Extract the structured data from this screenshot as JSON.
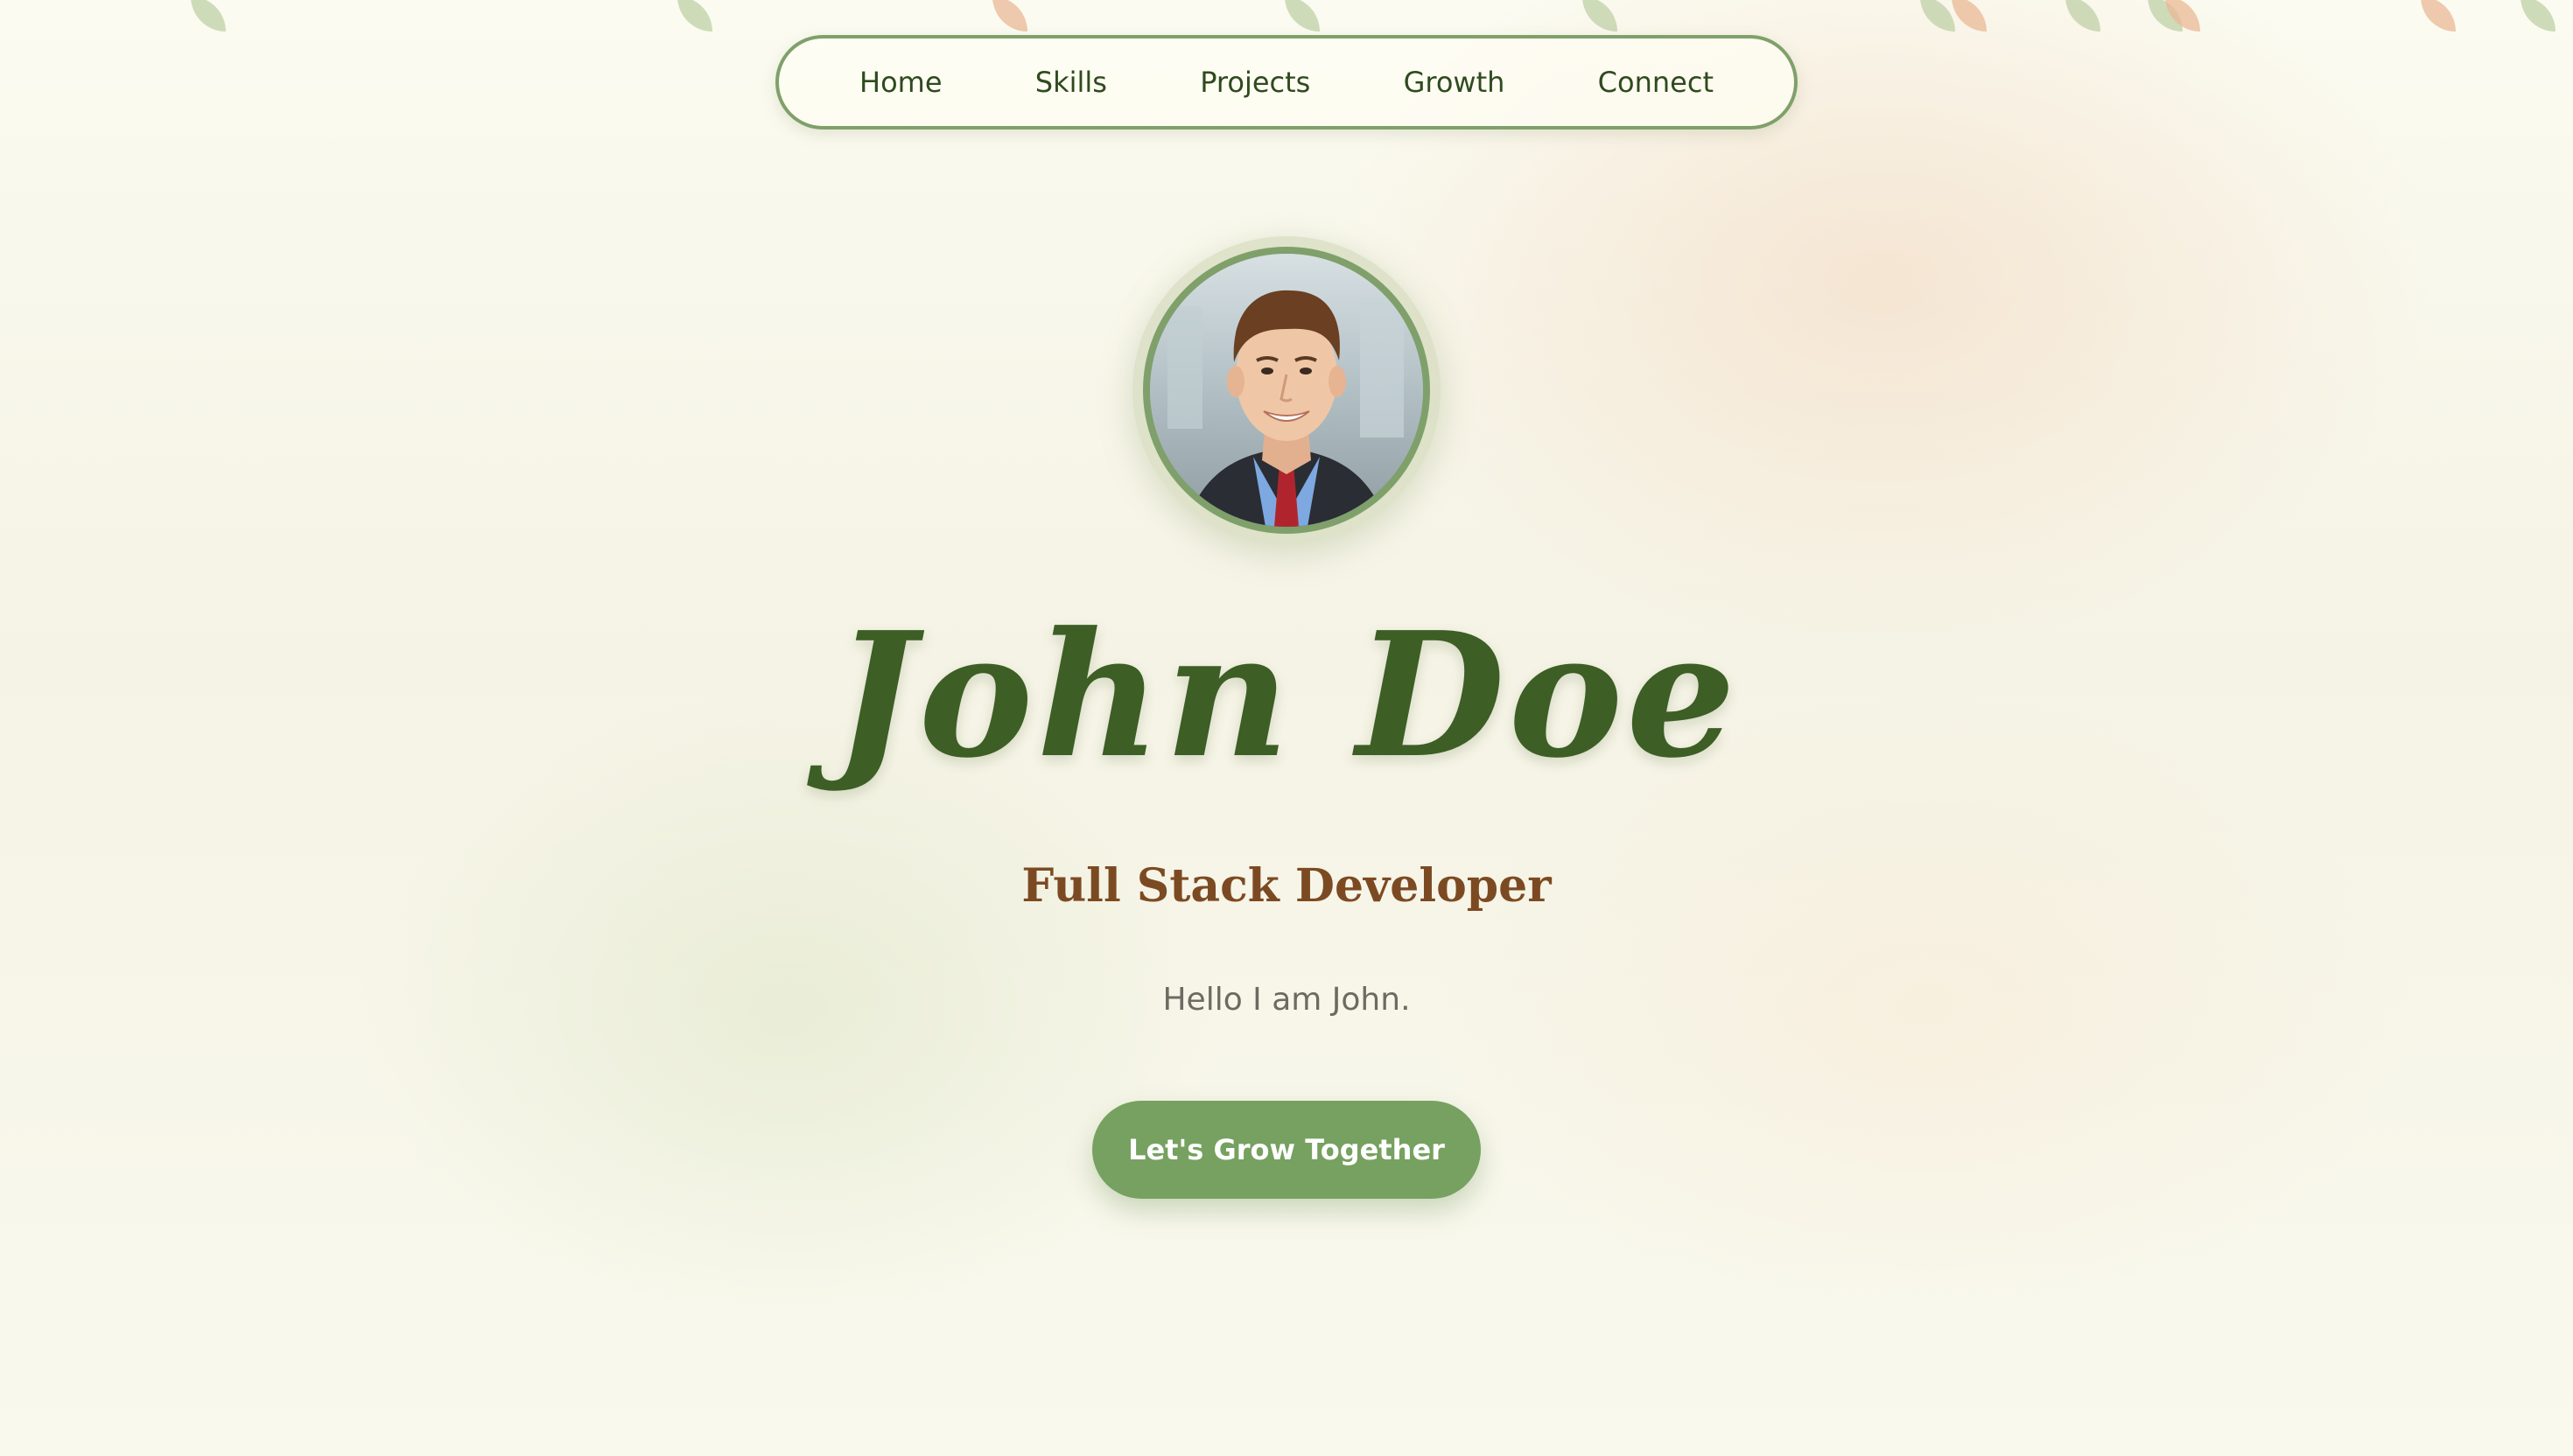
{
  "nav": {
    "items": [
      {
        "label": "Home"
      },
      {
        "label": "Skills"
      },
      {
        "label": "Projects"
      },
      {
        "label": "Growth"
      },
      {
        "label": "Connect"
      }
    ]
  },
  "hero": {
    "name": "John Doe",
    "role": "Full Stack Developer",
    "greeting": "Hello I am John.",
    "cta_label": "Let's Grow Together"
  },
  "colors": {
    "accent_green": "#76a160",
    "nav_border": "#7fa06a",
    "name_green": "#3d5e25",
    "role_brown": "#7c4a22",
    "leaf_green": "#bfd0a6",
    "leaf_peach": "#e9b896"
  }
}
